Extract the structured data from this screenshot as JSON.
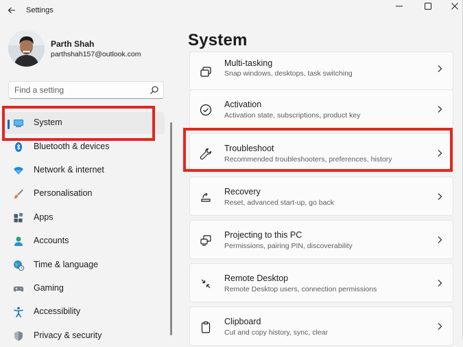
{
  "window": {
    "title": "Settings"
  },
  "user": {
    "name": "Parth Shah",
    "email": "parthshah157@outlook.com"
  },
  "search": {
    "placeholder": "Find a setting"
  },
  "nav": {
    "items": [
      {
        "label": "System",
        "icon": "monitor-icon",
        "active": true
      },
      {
        "label": "Bluetooth & devices",
        "icon": "bluetooth-icon"
      },
      {
        "label": "Network & internet",
        "icon": "wifi-icon"
      },
      {
        "label": "Personalisation",
        "icon": "brush-icon"
      },
      {
        "label": "Apps",
        "icon": "apps-icon"
      },
      {
        "label": "Accounts",
        "icon": "person-icon"
      },
      {
        "label": "Time & language",
        "icon": "globe-clock-icon"
      },
      {
        "label": "Gaming",
        "icon": "gamepad-icon"
      },
      {
        "label": "Accessibility",
        "icon": "accessibility-icon"
      },
      {
        "label": "Privacy & security",
        "icon": "shield-icon"
      }
    ]
  },
  "main": {
    "title": "System",
    "cards": [
      {
        "title": "Multi-tasking",
        "desc": "Snap windows, desktops, task switching",
        "icon": "multitasking-icon"
      },
      {
        "title": "Activation",
        "desc": "Activation state, subscriptions, product key",
        "icon": "check-circle-icon"
      },
      {
        "title": "Troubleshoot",
        "desc": "Recommended troubleshooters, preferences, history",
        "icon": "wrench-icon"
      },
      {
        "title": "Recovery",
        "desc": "Reset, advanced start-up, go back",
        "icon": "recovery-icon"
      },
      {
        "title": "Projecting to this PC",
        "desc": "Permissions, pairing PIN, discoverability",
        "icon": "projector-icon"
      },
      {
        "title": "Remote Desktop",
        "desc": "Remote Desktop users, connection permissions",
        "icon": "remote-desktop-icon"
      },
      {
        "title": "Clipboard",
        "desc": "Cut and copy history, sync, clear",
        "icon": "clipboard-icon"
      }
    ]
  },
  "colors": {
    "accent": "#0067c0",
    "highlight": "#e0281e",
    "background": "#f3f3f3",
    "card": "#fbfbfb"
  }
}
